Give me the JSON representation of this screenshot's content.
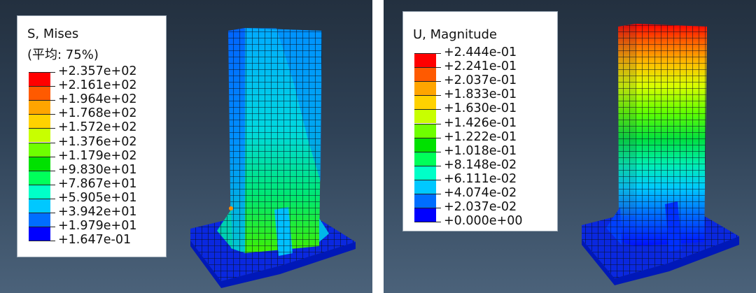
{
  "colors": {
    "bands": [
      "#ff0000",
      "#ff5a00",
      "#ffa500",
      "#ffd200",
      "#c8ff00",
      "#6eff00",
      "#00e100",
      "#00ff5a",
      "#00ffc8",
      "#00c8ff",
      "#006eff",
      "#0000ff"
    ],
    "background_top": "#23303f",
    "background_bottom": "#4b627a"
  },
  "left_panel": {
    "legend": {
      "title": "S, Mises",
      "subtitle": "(平均: 75%)",
      "values": [
        "+2.357e+02",
        "+2.161e+02",
        "+1.964e+02",
        "+1.768e+02",
        "+1.572e+02",
        "+1.376e+02",
        "+1.179e+02",
        "+9.830e+01",
        "+7.867e+01",
        "+5.905e+01",
        "+3.942e+01",
        "+1.979e+01",
        "+1.647e-01"
      ]
    }
  },
  "right_panel": {
    "legend": {
      "title": "U, Magnitude",
      "values": [
        "+2.444e-01",
        "+2.241e-01",
        "+2.037e-01",
        "+1.833e-01",
        "+1.630e-01",
        "+1.426e-01",
        "+1.222e-01",
        "+1.018e-01",
        "+8.148e-02",
        "+6.111e-02",
        "+4.074e-02",
        "+2.037e-02",
        "+0.000e+00"
      ]
    }
  }
}
